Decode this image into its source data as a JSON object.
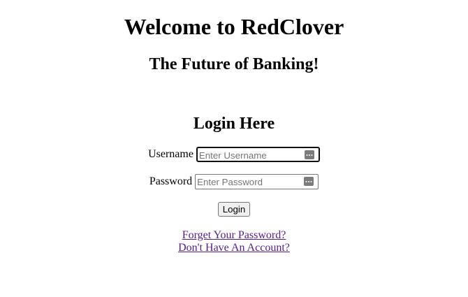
{
  "header": {
    "title": "Welcome to RedClover",
    "subtitle": "The Future of Banking!"
  },
  "login": {
    "heading": "Login Here",
    "username": {
      "label": "Username",
      "placeholder": "Enter Username",
      "value": ""
    },
    "password": {
      "label": "Password",
      "placeholder": "Enter Password",
      "value": ""
    },
    "submit_label": "Login"
  },
  "links": {
    "forgot_password": "Forget Your Password?",
    "create_account": "Don't Have An Account?"
  },
  "colors": {
    "visited_link": "#551a8b",
    "text": "#000000",
    "background": "#ffffff"
  },
  "icons": {
    "field_icon": "password-manager-icon"
  }
}
